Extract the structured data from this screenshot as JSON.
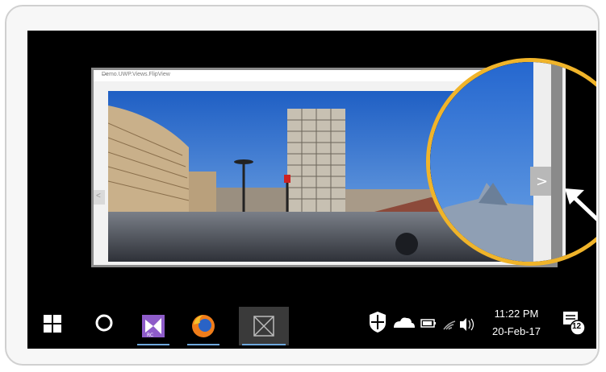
{
  "window": {
    "title": "Demo.UWP.Views.FlipView",
    "minimize_glyph": "—"
  },
  "flipview": {
    "prev_glyph": "<",
    "next_glyph": ">"
  },
  "taskbar": {
    "start_icon": "windows-logo-icon",
    "search_icon": "cortana-circle-icon",
    "apps": [
      "visual-studio-icon",
      "firefox-icon",
      "uwp-app-icon"
    ],
    "tray_icons": [
      "shield-icon",
      "cloud-icon",
      "battery-icon",
      "wifi-icon",
      "volume-icon"
    ],
    "time": "11:22 PM",
    "date": "20-Feb-17",
    "notification_count": "12"
  },
  "colors": {
    "magnifier_ring": "#f0b42a",
    "taskbar_accent": "#6ea8dd",
    "vs_purple": "#8e5cc9",
    "sky": "#2f6fd0"
  }
}
